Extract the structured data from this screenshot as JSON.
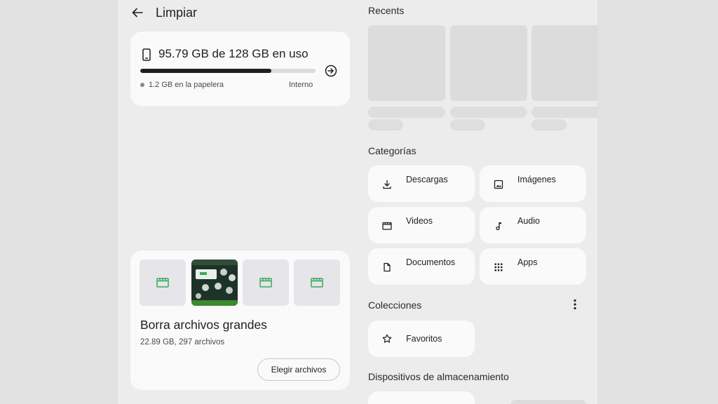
{
  "header": {
    "title": "Limpiar"
  },
  "storage": {
    "usage_text": "95.79 GB de 128 GB en uso",
    "used_fraction": 0.7484,
    "trash_text": "1.2 GB en la papelera",
    "location": "Interno"
  },
  "large_files": {
    "title": "Borra archivos grandes",
    "subtitle": "22.89 GB, 297 archivos",
    "button": "Elegir archivos"
  },
  "recents": {
    "title": "Recents"
  },
  "categories": {
    "title": "Categorías",
    "items": [
      {
        "label": "Descargas",
        "icon": "download-icon"
      },
      {
        "label": "Imágenes",
        "icon": "image-icon"
      },
      {
        "label": "Videos",
        "icon": "video-icon"
      },
      {
        "label": "Audio",
        "icon": "music-note-icon"
      },
      {
        "label": "Documentos",
        "icon": "document-icon"
      },
      {
        "label": "Apps",
        "icon": "apps-grid-icon"
      }
    ]
  },
  "collections": {
    "title": "Colecciones",
    "items": [
      {
        "label": "Favoritos",
        "icon": "star-icon"
      }
    ]
  },
  "devices": {
    "title": "Dispositivos de almacenamiento"
  },
  "colors": {
    "accent_green": "#3ea65a",
    "progress": "#1f1f1f"
  }
}
